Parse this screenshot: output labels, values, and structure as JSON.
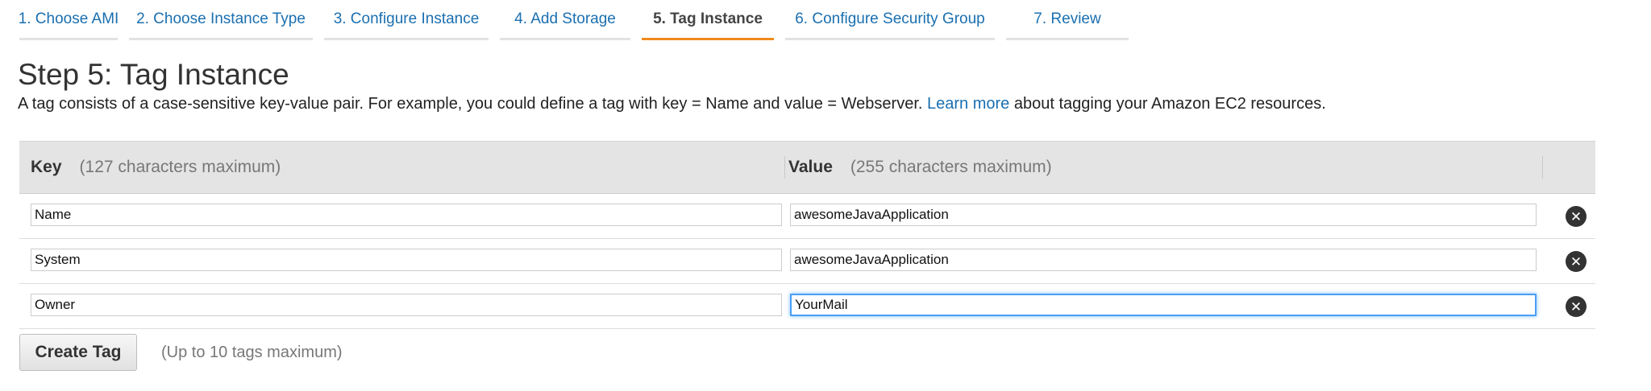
{
  "wizard": {
    "tabs": [
      {
        "label": "1. Choose AMI",
        "active": false
      },
      {
        "label": "2. Choose Instance Type",
        "active": false
      },
      {
        "label": "3. Configure Instance",
        "active": false
      },
      {
        "label": "4. Add Storage",
        "active": false
      },
      {
        "label": "5. Tag Instance",
        "active": true
      },
      {
        "label": "6. Configure Security Group",
        "active": false
      },
      {
        "label": "7. Review",
        "active": false
      }
    ]
  },
  "page": {
    "title": "Step 5: Tag Instance",
    "description_before": "A tag consists of a case-sensitive key-value pair. For example, you could define a tag with key = Name and value = Webserver.",
    "learn_more": "Learn more",
    "description_after": "about tagging your Amazon EC2 resources."
  },
  "table": {
    "key_header": "Key",
    "key_hint": "(127 characters maximum)",
    "value_header": "Value",
    "value_hint": "(255 characters maximum)",
    "rows": [
      {
        "key": "Name",
        "value": "awesomeJavaApplication"
      },
      {
        "key": "System",
        "value": "awesomeJavaApplication"
      },
      {
        "key": "Owner",
        "value": "YourMail"
      }
    ],
    "remove_icon": "remove-circle-icon"
  },
  "actions": {
    "create_tag_label": "Create Tag",
    "limit_note": "(Up to 10 tags maximum)"
  },
  "colors": {
    "link": "#1a6fb0",
    "active_tab_underline": "#f08b1d",
    "focus_border": "#4a9ff5"
  }
}
